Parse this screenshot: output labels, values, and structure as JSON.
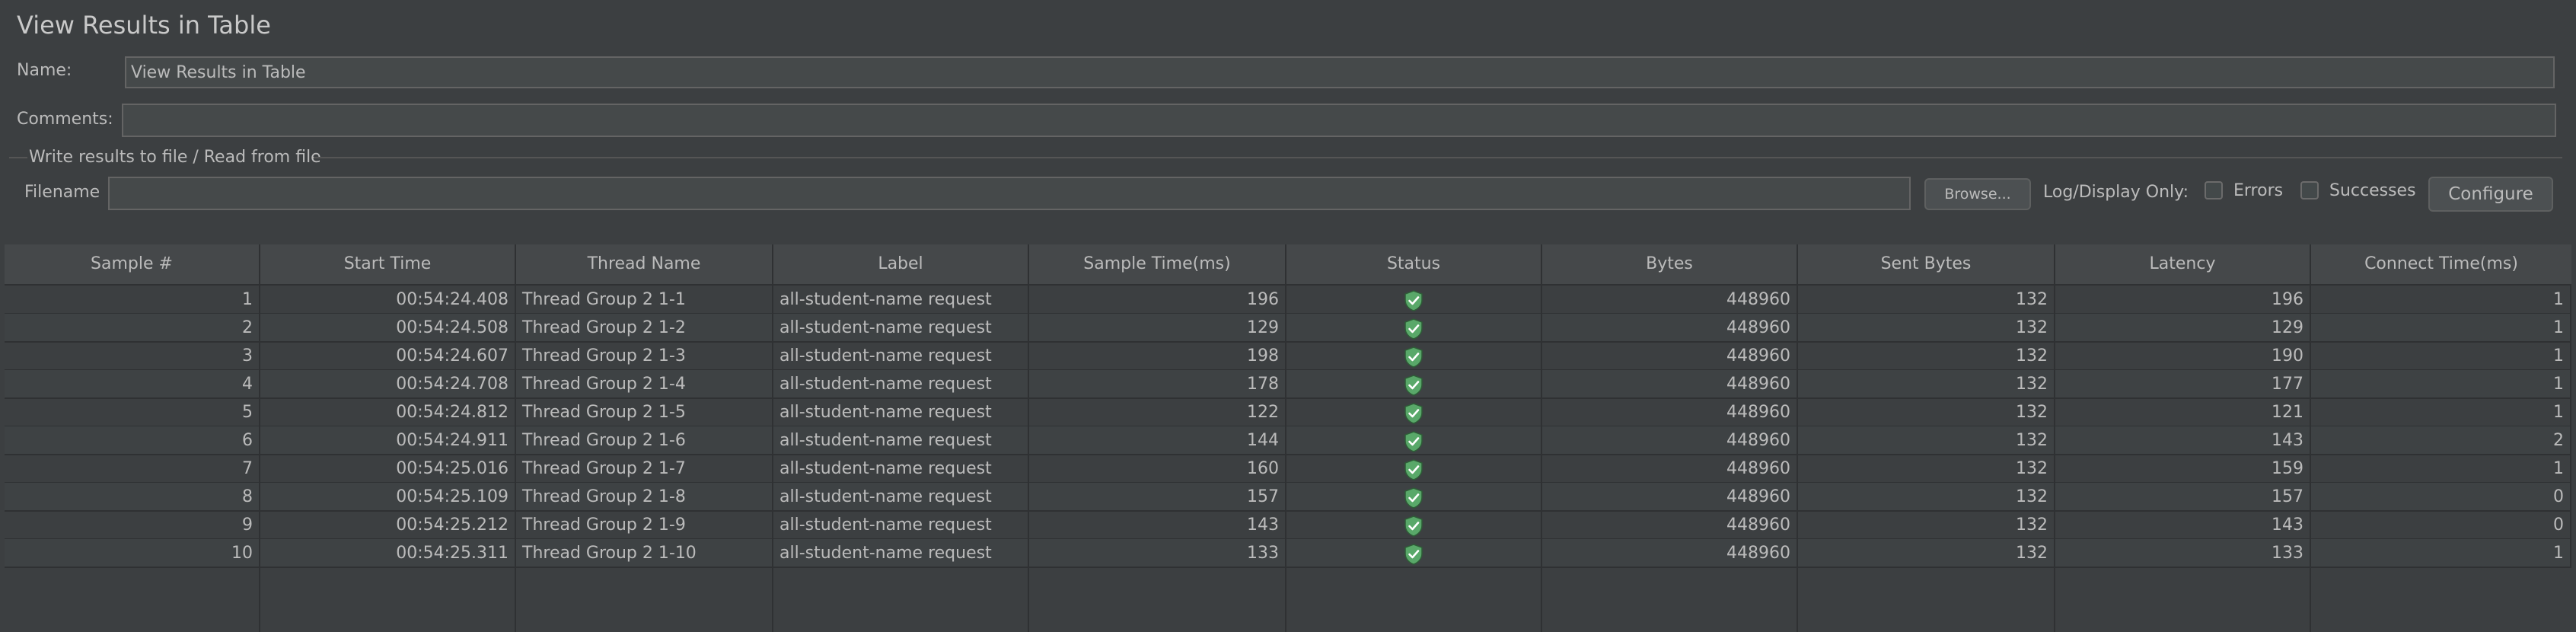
{
  "panel": {
    "title": "View Results in Table"
  },
  "form": {
    "name_label": "Name:",
    "name_value": "View Results in Table",
    "comments_label": "Comments:",
    "comments_value": ""
  },
  "file_group": {
    "title": "Write results to file / Read from file",
    "filename_label": "Filename",
    "filename_value": "",
    "browse_label": "Browse...",
    "log_display_label": "Log/Display Only:",
    "errors_label": "Errors",
    "errors_checked": false,
    "successes_label": "Successes",
    "successes_checked": false,
    "configure_label": "Configure"
  },
  "table": {
    "columns": [
      "Sample #",
      "Start Time",
      "Thread Name",
      "Label",
      "Sample Time(ms)",
      "Status",
      "Bytes",
      "Sent Bytes",
      "Latency",
      "Connect Time(ms)"
    ],
    "rows": [
      {
        "sample": "1",
        "start": "00:54:24.408",
        "thread": "Thread Group 2 1-1",
        "label": "all-student-name request",
        "time": "196",
        "status": "success-shield-icon",
        "bytes": "448960",
        "sent": "132",
        "latency": "196",
        "connect": "1"
      },
      {
        "sample": "2",
        "start": "00:54:24.508",
        "thread": "Thread Group 2 1-2",
        "label": "all-student-name request",
        "time": "129",
        "status": "success-shield-icon",
        "bytes": "448960",
        "sent": "132",
        "latency": "129",
        "connect": "1"
      },
      {
        "sample": "3",
        "start": "00:54:24.607",
        "thread": "Thread Group 2 1-3",
        "label": "all-student-name request",
        "time": "198",
        "status": "success-shield-icon",
        "bytes": "448960",
        "sent": "132",
        "latency": "190",
        "connect": "1"
      },
      {
        "sample": "4",
        "start": "00:54:24.708",
        "thread": "Thread Group 2 1-4",
        "label": "all-student-name request",
        "time": "178",
        "status": "success-shield-icon",
        "bytes": "448960",
        "sent": "132",
        "latency": "177",
        "connect": "1"
      },
      {
        "sample": "5",
        "start": "00:54:24.812",
        "thread": "Thread Group 2 1-5",
        "label": "all-student-name request",
        "time": "122",
        "status": "success-shield-icon",
        "bytes": "448960",
        "sent": "132",
        "latency": "121",
        "connect": "1"
      },
      {
        "sample": "6",
        "start": "00:54:24.911",
        "thread": "Thread Group 2 1-6",
        "label": "all-student-name request",
        "time": "144",
        "status": "success-shield-icon",
        "bytes": "448960",
        "sent": "132",
        "latency": "143",
        "connect": "2"
      },
      {
        "sample": "7",
        "start": "00:54:25.016",
        "thread": "Thread Group 2 1-7",
        "label": "all-student-name request",
        "time": "160",
        "status": "success-shield-icon",
        "bytes": "448960",
        "sent": "132",
        "latency": "159",
        "connect": "1"
      },
      {
        "sample": "8",
        "start": "00:54:25.109",
        "thread": "Thread Group 2 1-8",
        "label": "all-student-name request",
        "time": "157",
        "status": "success-shield-icon",
        "bytes": "448960",
        "sent": "132",
        "latency": "157",
        "connect": "0"
      },
      {
        "sample": "9",
        "start": "00:54:25.212",
        "thread": "Thread Group 2 1-9",
        "label": "all-student-name request",
        "time": "143",
        "status": "success-shield-icon",
        "bytes": "448960",
        "sent": "132",
        "latency": "143",
        "connect": "0"
      },
      {
        "sample": "10",
        "start": "00:54:25.311",
        "thread": "Thread Group 2 1-10",
        "label": "all-student-name request",
        "time": "133",
        "status": "success-shield-icon",
        "bytes": "448960",
        "sent": "132",
        "latency": "133",
        "connect": "1"
      }
    ]
  },
  "colors": {
    "background": "#3c3f41",
    "text": "#bbbbbb",
    "success_shield": "#59a869"
  }
}
